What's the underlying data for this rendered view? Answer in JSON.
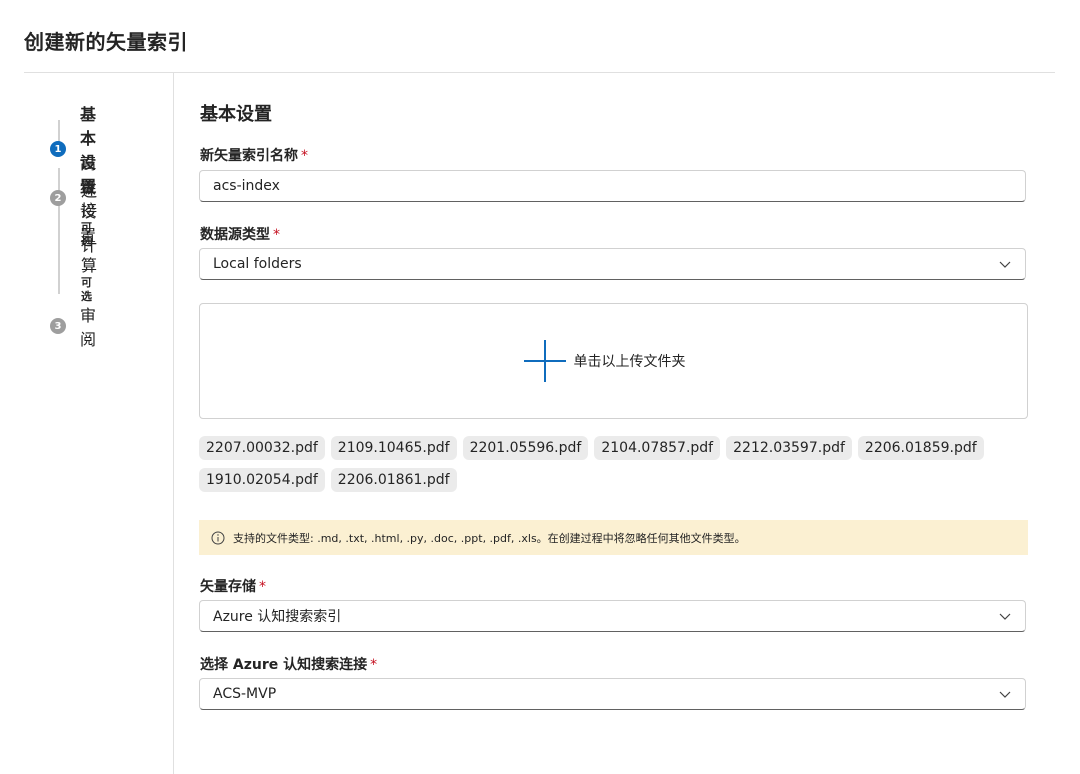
{
  "dialog": {
    "title": "创建新的矢量索引"
  },
  "stepper": {
    "steps": [
      {
        "num": "1",
        "label": "基本设置",
        "active": true
      },
      {
        "num": "2",
        "label": "高级设置",
        "active": false
      },
      {
        "num": "3",
        "label": "审阅",
        "active": false
      }
    ],
    "substeps": [
      {
        "title": "连接",
        "optional": "可选"
      },
      {
        "title": "计算",
        "optional": "可选"
      }
    ]
  },
  "form": {
    "section_title": "基本设置",
    "required_mark": "*",
    "index_name": {
      "label": "新矢量索引名称",
      "value": "acs-index"
    },
    "datasource_type": {
      "label": "数据源类型",
      "value": "Local folders"
    },
    "upload": {
      "label": "单击以上传文件夹"
    },
    "files": [
      "2207.00032.pdf",
      "2109.10465.pdf",
      "2201.05596.pdf",
      "2104.07857.pdf",
      "2212.03597.pdf",
      "2206.01859.pdf",
      "1910.02054.pdf",
      "2206.01861.pdf"
    ],
    "info": "支持的文件类型: .md, .txt, .html, .py, .doc, .ppt, .pdf, .xls。在创建过程中将忽略任何其他文件类型。",
    "vector_store": {
      "label": "矢量存储",
      "value": "Azure 认知搜索索引"
    },
    "acs_connection": {
      "label": "选择 Azure 认知搜索连接",
      "value": "ACS-MVP"
    }
  },
  "colors": {
    "accent": "#0f6cbd",
    "required": "#c50f1f",
    "info_bg": "#fbf0d2",
    "chip_bg": "#ebebeb"
  }
}
